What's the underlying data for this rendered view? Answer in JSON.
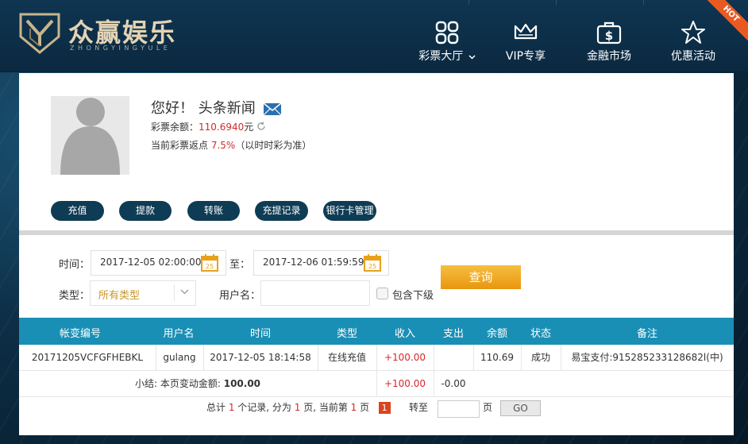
{
  "brand": {
    "name": "众赢娱乐",
    "sub": "ZHONGYINGYULE"
  },
  "nav": [
    {
      "label": "彩票大厅",
      "icon": "grid-icon",
      "has_dropdown": true
    },
    {
      "label": "VIP专享",
      "icon": "crown-icon"
    },
    {
      "label": "金融市场",
      "icon": "dollar-briefcase-icon"
    },
    {
      "label": "优惠活动",
      "icon": "star-icon"
    }
  ],
  "hot_badge": "HOT",
  "user": {
    "greeting": "您好！ 头条新闻",
    "balance_label": "彩票余额：",
    "balance_value": "110.6940",
    "balance_unit": "元",
    "rebate_label": "当前彩票返点",
    "rebate_value": "7.5%",
    "rebate_note": "（以时时彩为准）"
  },
  "actions": [
    "充值",
    "提款",
    "转账",
    "充提记录",
    "银行卡管理"
  ],
  "filters": {
    "time_label": "时间：",
    "start": "2017-12-05 02:00:00",
    "to_label": "至：",
    "end": "2017-12-06 01:59:59",
    "calendar_day": "25",
    "type_label": "类型：",
    "type_value": "所有类型",
    "username_label": "用户名：",
    "username_value": "",
    "include_sub_label": "包含下级",
    "query_button": "查询"
  },
  "table": {
    "headers": [
      "帐变编号",
      "用户名",
      "时间",
      "类型",
      "收入",
      "支出",
      "余额",
      "状态",
      "备注"
    ],
    "rows": [
      [
        "20171205VCFGFHEBKL",
        "gulang",
        "2017-12-05 18:14:58",
        "在线充值",
        "+100.00",
        "",
        "110.69",
        "成功",
        "易宝支付:915285233128682l(中)"
      ]
    ],
    "summary": {
      "label": "小结: 本页变动金额: ",
      "amount": "100.00",
      "income": "+100.00",
      "expense": "-0.00"
    }
  },
  "pager": {
    "total_prefix": "总计 ",
    "total": "1",
    "records_text": " 个记录, 分为 ",
    "pages": "1",
    "pages_text": " 页, 当前第 ",
    "current": "1",
    "page_suffix": " 页",
    "goto_label": "转至",
    "goto_value": "",
    "page_label": "页",
    "go_button": "GO"
  },
  "colors": {
    "header_bg": "#0f3551",
    "table_head": "#1a8fb5",
    "button_dark": "#0f3c55",
    "accent_red": "#d52a2a",
    "query_orange": "#f0a822"
  }
}
